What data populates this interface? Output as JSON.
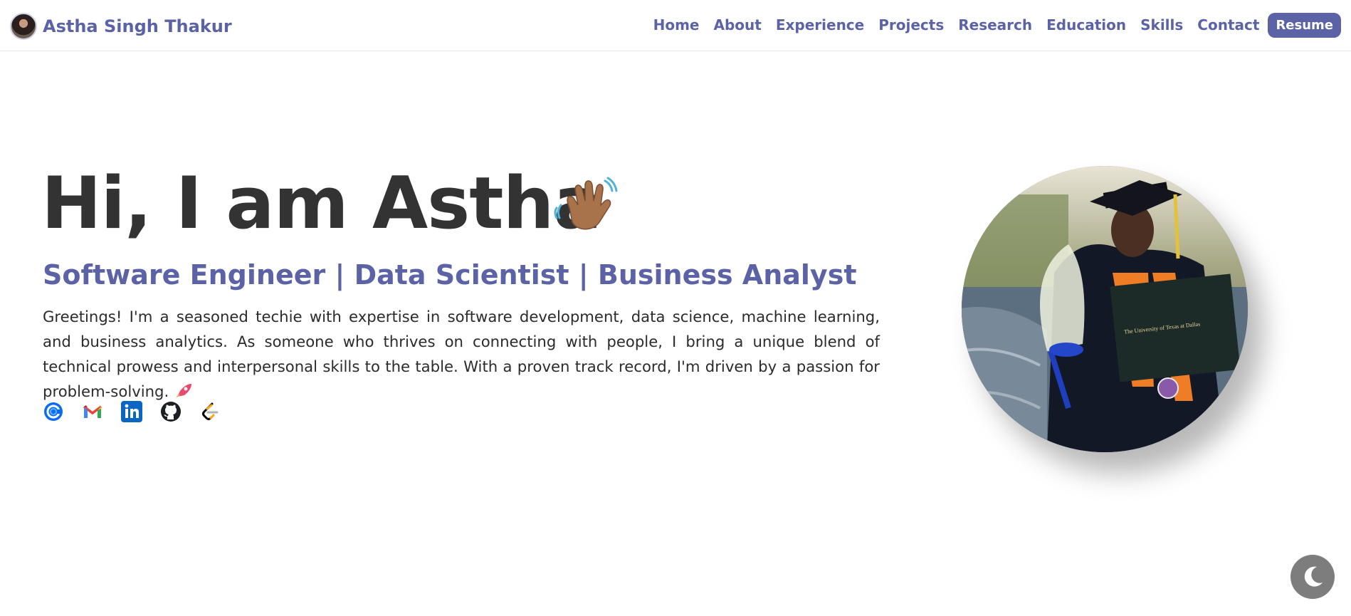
{
  "brand": {
    "name": "Astha Singh Thakur"
  },
  "nav": {
    "links": [
      "Home",
      "About",
      "Experience",
      "Projects",
      "Research",
      "Education",
      "Skills",
      "Contact"
    ],
    "resume_label": "Resume"
  },
  "hero": {
    "greeting": "Hi, I am Astha",
    "subtitle": "Software Engineer | Data Scientist | Business Analyst",
    "intro": "Greetings! I'm a seasoned techie with expertise in software development, data science, machine learning, and business analytics. As someone who thrives on connecting with people, I bring a unique blend of technical prowess and interpersonal skills to the table. With a proven track record, I'm driven by a passion for problem-solving.",
    "diploma_text": "The University of Texas at Dallas"
  },
  "socials": [
    "calendly-icon",
    "gmail-icon",
    "linkedin-icon",
    "github-icon",
    "leetcode-icon"
  ],
  "colors": {
    "accent": "#5b63a6",
    "heading": "#333333",
    "toggle_bg": "#7d7d7d"
  }
}
